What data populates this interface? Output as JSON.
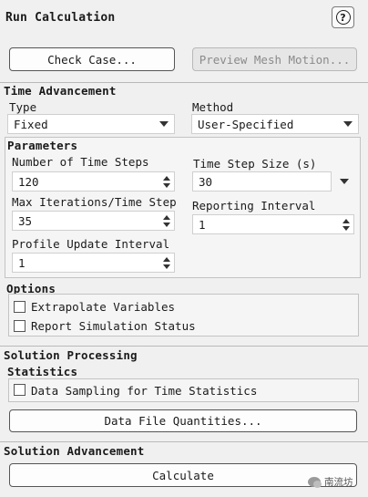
{
  "panel": {
    "title": "Run Calculation",
    "help_glyph": "?"
  },
  "top_buttons": {
    "check_case": "Check Case...",
    "preview_mesh_motion": "Preview Mesh Motion..."
  },
  "time_advancement": {
    "header": "Time Advancement",
    "type_label": "Type",
    "type_value": "Fixed",
    "method_label": "Method",
    "method_value": "User-Specified"
  },
  "parameters": {
    "header": "Parameters",
    "num_time_steps_label": "Number of Time Steps",
    "num_time_steps_value": "120",
    "time_step_size_label": "Time Step Size (s)",
    "time_step_size_value": "30",
    "max_iter_label": "Max Iterations/Time Step",
    "max_iter_value": "35",
    "reporting_interval_label": "Reporting Interval",
    "reporting_interval_value": "1",
    "profile_update_label": "Profile Update Interval",
    "profile_update_value": "1"
  },
  "options": {
    "header": "Options",
    "extrapolate_label": "Extrapolate Variables",
    "extrapolate_checked": false,
    "report_status_label": "Report Simulation Status",
    "report_status_checked": false
  },
  "solution_processing": {
    "header": "Solution Processing",
    "statistics_header": "Statistics",
    "data_sampling_label": "Data Sampling for Time Statistics",
    "data_sampling_checked": false,
    "data_file_quantities_button": "Data File Quantities..."
  },
  "solution_advancement": {
    "header": "Solution Advancement",
    "calculate_button": "Calculate"
  },
  "watermark": {
    "text": "南流坊"
  }
}
